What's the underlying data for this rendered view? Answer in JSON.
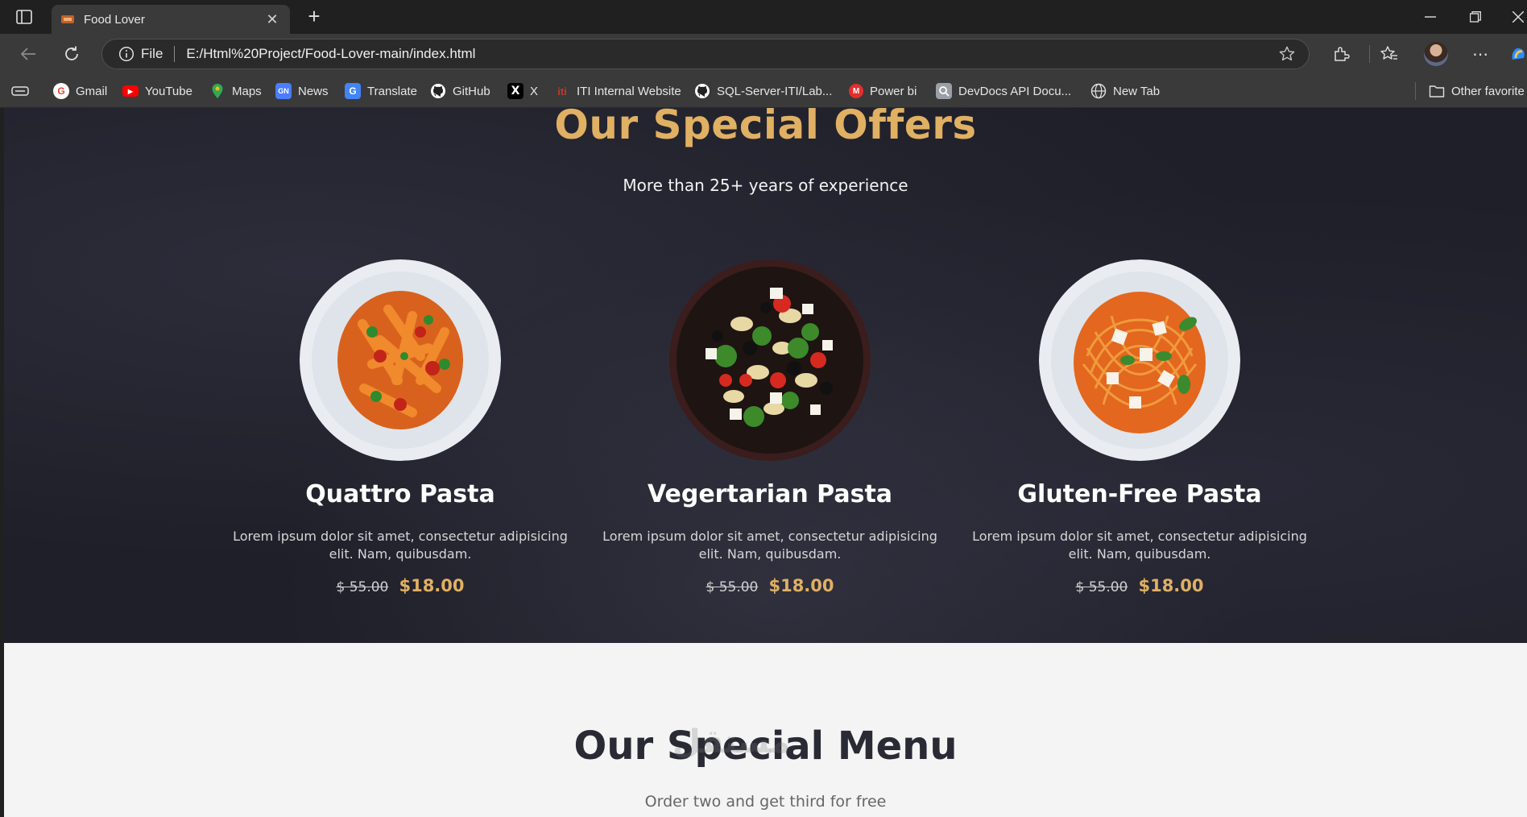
{
  "browser": {
    "tab_title": "Food Lover",
    "address_scheme": "File",
    "address_url": "E:/Html%20Project/Food-Lover-main/index.html",
    "bookmarks": [
      {
        "label": "Gmail",
        "icon": "gmail-icon",
        "color": "#ea4335"
      },
      {
        "label": "YouTube",
        "icon": "youtube-icon",
        "color": "#ff0000"
      },
      {
        "label": "Maps",
        "icon": "maps-icon",
        "color": "#34a853"
      },
      {
        "label": "News",
        "icon": "news-icon",
        "color": "#4a7dff"
      },
      {
        "label": "Translate",
        "icon": "translate-icon",
        "color": "#4285f4"
      },
      {
        "label": "GitHub",
        "icon": "github-icon",
        "color": "#ffffff"
      },
      {
        "label": "X",
        "icon": "x-icon",
        "color": "#ffffff"
      },
      {
        "label": "ITI Internal Website",
        "icon": "iti-icon",
        "color": "#c0392b"
      },
      {
        "label": "SQL-Server-ITI/Lab...",
        "icon": "github-icon",
        "color": "#ffffff"
      },
      {
        "label": "Power bi",
        "icon": "powerbi-icon",
        "color": "#e52d2d"
      },
      {
        "label": "DevDocs API Docu...",
        "icon": "devdocs-icon",
        "color": "#9aa0a6"
      },
      {
        "label": "New Tab",
        "icon": "globe-icon",
        "color": "#e0e0e0"
      }
    ],
    "other_favorites": "Other favorite"
  },
  "offers": {
    "title": "Our Special Offers",
    "subtitle": "More than 25+ years of experience",
    "items": [
      {
        "name": "Quattro Pasta",
        "description": "Lorem ipsum dolor sit amet, consectetur adipisicing elit. Nam, quibusdam.",
        "old_price": "$ 55.00",
        "price": "$18.00"
      },
      {
        "name": "Vegertarian Pasta",
        "description": "Lorem ipsum dolor sit amet, consectetur adipisicing elit. Nam, quibusdam.",
        "old_price": "$ 55.00",
        "price": "$18.00"
      },
      {
        "name": "Gluten-Free Pasta",
        "description": "Lorem ipsum dolor sit amet, consectetur adipisicing elit. Nam, quibusdam.",
        "old_price": "$ 55.00",
        "price": "$18.00"
      }
    ]
  },
  "menu": {
    "title": "Our Special Menu",
    "subtitle": "Order two and get third for free"
  },
  "colors": {
    "accent": "#e0b063",
    "dark_bg": "#1f1f29",
    "light_bg": "#f4f4f4"
  }
}
